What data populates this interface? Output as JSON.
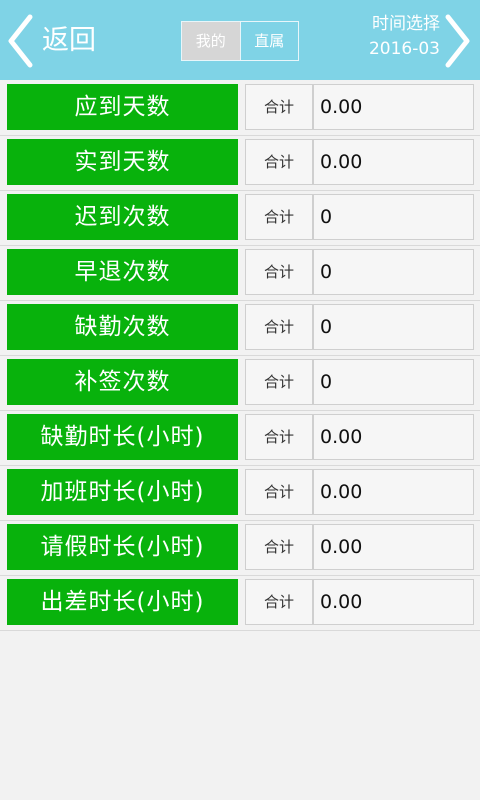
{
  "header": {
    "back_label": "返回",
    "tabs": [
      {
        "label": "我的"
      },
      {
        "label": "直属"
      }
    ],
    "date_title": "时间选择",
    "date_value": "2016-03"
  },
  "rows": [
    {
      "label": "应到天数",
      "sum": "合计",
      "value": "0.00"
    },
    {
      "label": "实到天数",
      "sum": "合计",
      "value": "0.00"
    },
    {
      "label": "迟到次数",
      "sum": "合计",
      "value": "0"
    },
    {
      "label": "早退次数",
      "sum": "合计",
      "value": "0"
    },
    {
      "label": "缺勤次数",
      "sum": "合计",
      "value": "0"
    },
    {
      "label": "补签次数",
      "sum": "合计",
      "value": "0"
    },
    {
      "label": "缺勤时长(小时)",
      "sum": "合计",
      "value": "0.00"
    },
    {
      "label": "加班时长(小时)",
      "sum": "合计",
      "value": "0.00"
    },
    {
      "label": "请假时长(小时)",
      "sum": "合计",
      "value": "0.00"
    },
    {
      "label": "出差时长(小时)",
      "sum": "合计",
      "value": "0.00"
    }
  ],
  "colors": {
    "header_bg": "#7fd3e6",
    "label_bg": "#08b20c",
    "active_tab_bg": "#d6d6d6"
  },
  "icons": {
    "back": "chevron-left-icon",
    "next": "chevron-right-icon"
  }
}
